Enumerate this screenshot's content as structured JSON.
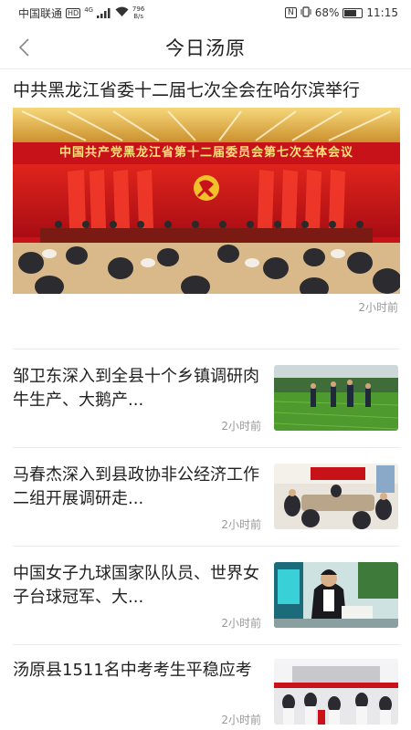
{
  "status_bar": {
    "carrier": "中国联通",
    "hd": "HD",
    "network": "4G",
    "speed_value": "796",
    "speed_unit": "B/s",
    "nfc": "N",
    "battery_percent": "68%",
    "battery_level": 0.68,
    "time": "11:15"
  },
  "nav": {
    "title": "今日汤原",
    "back_icon": "chevron-left-icon"
  },
  "feature": {
    "title": "中共黑龙江省委十二届七次全会在哈尔滨举行",
    "banner_text": "中国共产党黑龙江省第十二届委员会第七次全体会议",
    "time": "2小时前"
  },
  "articles": [
    {
      "title": "邹卫东深入到全县十个乡镇调研肉牛生产、大鹅产...",
      "time": "2小时前"
    },
    {
      "title": "马春杰深入到县政协非公经济工作二组开展调研走...",
      "time": "2小时前"
    },
    {
      "title": "中国女子九球国家队队员、世界女子台球冠军、大...",
      "time": "2小时前"
    },
    {
      "title": "汤原县1511名中考考生平稳应考",
      "time": "2小时前"
    }
  ],
  "colors": {
    "accent_red": "#c8121a",
    "gold": "#f2c02a",
    "text": "#222222",
    "muted": "#999999"
  }
}
